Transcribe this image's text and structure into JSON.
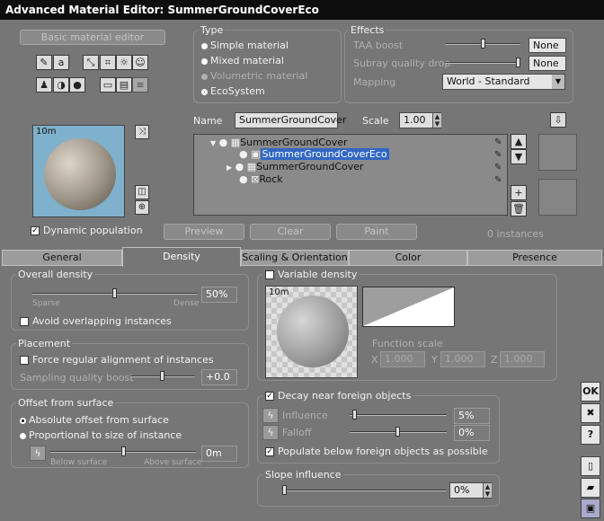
{
  "window": {
    "title": "Advanced Material Editor: SummerGroundCoverEco"
  },
  "left": {
    "basic_btn": "Basic material editor",
    "preview_size": "10m",
    "dynamic_population": "Dynamic population"
  },
  "type": {
    "title": "Type",
    "options": [
      "Simple material",
      "Mixed material",
      "Volumetric material",
      "EcoSystem"
    ],
    "selected": "EcoSystem"
  },
  "effects": {
    "title": "Effects",
    "taa_label": "TAA boost",
    "taa_value": "None",
    "subray_label": "Subray quality drop",
    "subray_value": "None",
    "mapping_label": "Mapping",
    "mapping_value": "World - Standard"
  },
  "name_row": {
    "name_label": "Name",
    "name_value": "SummerGroundCover",
    "scale_label": "Scale",
    "scale_value": "1.00"
  },
  "tree": {
    "items": [
      "SummerGroundCover",
      "SummerGroundCoverEco",
      "SummerGroundCover",
      "Rock"
    ]
  },
  "actions": {
    "preview": "Preview",
    "clear": "Clear",
    "paint": "Paint",
    "instances": "0 instances"
  },
  "tabs": [
    "General",
    "Density",
    "Scaling & Orientation",
    "Color",
    "Presence"
  ],
  "density": {
    "overall_title": "Overall density",
    "sparse": "Sparse",
    "dense": "Dense",
    "overall_value": "50%",
    "overall_level": 0.5,
    "avoid_overlap": "Avoid overlapping instances",
    "placement_title": "Placement",
    "force_regular": "Force regular alignment of instances",
    "sampling_label": "Sampling quality boost",
    "sampling_value": "+0.0",
    "offset_title": "Offset from surface",
    "absolute_offset": "Absolute offset from surface",
    "proportional": "Proportional to size of instance",
    "below": "Below surface",
    "above": "Above surface",
    "offset_value": "0m"
  },
  "variable": {
    "title": "Variable density",
    "preview_size": "10m",
    "function_scale": "Function scale",
    "x_label": "X",
    "y_label": "Y",
    "z_label": "Z",
    "x": "1.000",
    "y": "1.000",
    "z": "1.000"
  },
  "decay": {
    "title": "Decay near foreign objects",
    "influence_label": "Influence",
    "influence_value": "5%",
    "falloff_label": "Falloff",
    "falloff_value": "0%",
    "populate_below": "Populate below foreign objects as possible"
  },
  "slope": {
    "title": "Slope influence",
    "value": "0%"
  },
  "right_buttons": {
    "ok": "OK",
    "close": "✖",
    "help": "?"
  }
}
